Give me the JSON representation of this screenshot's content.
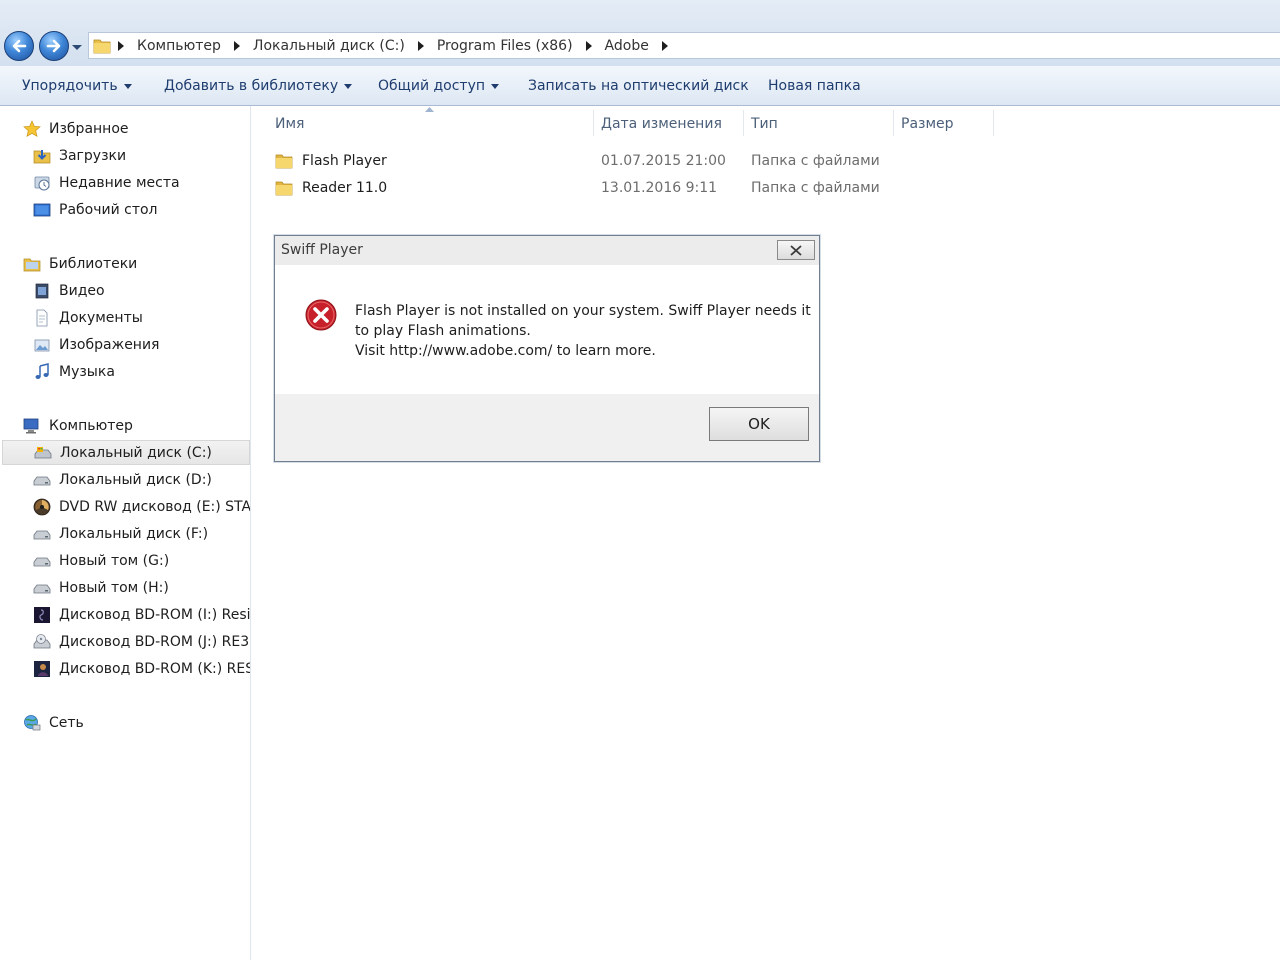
{
  "breadcrumb": {
    "items": [
      "Компьютер",
      "Локальный диск (C:)",
      "Program Files (x86)",
      "Adobe"
    ]
  },
  "toolbar": {
    "organize": "Упорядочить",
    "add_to_library": "Добавить в библиотеку",
    "share": "Общий доступ",
    "burn": "Записать на оптический диск",
    "new_folder": "Новая папка"
  },
  "navigation": {
    "favorites": {
      "title": "Избранное",
      "items": [
        "Загрузки",
        "Недавние места",
        "Рабочий стол"
      ]
    },
    "libraries": {
      "title": "Библиотеки",
      "items": [
        "Видео",
        "Документы",
        "Изображения",
        "Музыка"
      ]
    },
    "computer": {
      "title": "Компьютер",
      "items": [
        "Локальный диск (C:)",
        "Локальный диск (D:)",
        "DVD RW дисковод (E:) STALKER",
        "Локальный диск (F:)",
        "Новый том (G:)",
        "Новый том (H:)",
        "Дисковод BD-ROM (I:) Resident Evil",
        "Дисковод BD-ROM (J:) RE3",
        "Дисковод BD-ROM (K:) RESIDENT EVIL"
      ]
    },
    "network": {
      "title": "Сеть"
    }
  },
  "file_list": {
    "columns": {
      "name": "Имя",
      "modified": "Дата изменения",
      "type": "Тип",
      "size": "Размер"
    },
    "rows": [
      {
        "name": "Flash Player",
        "modified": "01.07.2015 21:00",
        "type": "Папка с файлами"
      },
      {
        "name": "Reader 11.0",
        "modified": "13.01.2016 9:11",
        "type": "Папка с файлами"
      }
    ]
  },
  "dialog": {
    "title": "Swiff Player",
    "message_line1": "Flash Player is not installed on your system. Swiff Player needs it",
    "message_line2": "to play Flash animations.",
    "message_line3": "Visit http://www.adobe.com/ to learn more.",
    "ok_label": "OK"
  },
  "colors": {
    "toolbar_text": "#1e3d6e",
    "error_red": "#c8202a",
    "folder_yellow": "#e8c04a"
  }
}
